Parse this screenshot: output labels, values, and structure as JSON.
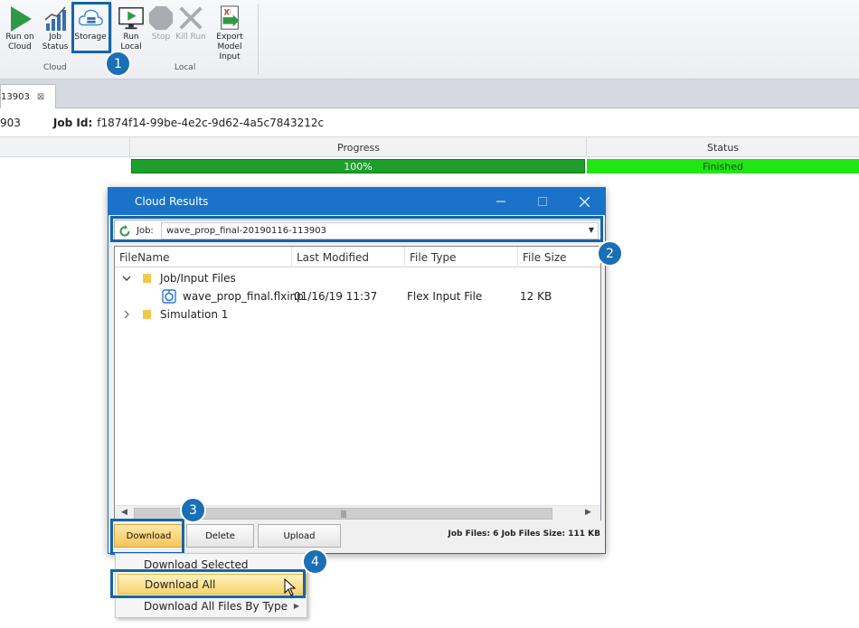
{
  "ribbon": {
    "buttons": [
      {
        "label_1": "Run on",
        "label_2": "Cloud",
        "icon": "play-icon",
        "color": "#2e9a47"
      },
      {
        "label_1": "Job",
        "label_2": "Status",
        "icon": "bar-chart-icon"
      },
      {
        "label_1": "Storage",
        "label_2": "",
        "icon": "cloud-storage-icon"
      },
      {
        "label_1": "Run",
        "label_2": "Local",
        "icon": "monitor-play-icon"
      },
      {
        "label_1": "Stop",
        "label_2": "",
        "icon": "stop-octagon-icon",
        "disabled": true
      },
      {
        "label_1": "Kill Run",
        "label_2": "",
        "icon": "x-icon",
        "disabled": true
      },
      {
        "label_1": "Export Model",
        "label_2": "Input",
        "icon": "export-document-icon"
      }
    ],
    "groups": {
      "cloud": "Cloud",
      "local": "Local"
    }
  },
  "callouts": {
    "one": "1",
    "two": "2",
    "three": "3",
    "four": "4"
  },
  "tab": {
    "label": "13903",
    "close": "⊠"
  },
  "jobline": {
    "prefix": "903",
    "job_id_label": "Job Id:",
    "job_id_value": "f1874f14-99be-4e2c-9d62-4a5c7843212c"
  },
  "grid": {
    "headers": {
      "progress": "Progress",
      "status": "Status"
    },
    "row": {
      "progress_text": "100%",
      "progress_value": 100,
      "status_text": "Finished"
    },
    "colors": {
      "progress": "#1e9e2a",
      "status": "#22e515"
    }
  },
  "dialog": {
    "title": "Cloud Results",
    "job_label": "Job:",
    "job_value": "wave_prop_final-20190116-113903",
    "columns": {
      "filename": "FileName",
      "modified": "Last Modified",
      "type": "File Type",
      "size": "File Size"
    },
    "tree": [
      {
        "name": "Job/Input Files",
        "expanded": true,
        "folder": true
      },
      {
        "name": "wave_prop_final.flxinp",
        "modified": "01/16/19 11:37",
        "type": "Flex Input File",
        "size": "12 KB",
        "folder": false
      },
      {
        "name": "Simulation 1",
        "expanded": false,
        "folder": true
      }
    ],
    "buttons": {
      "download": "Download",
      "delete": "Delete",
      "upload": "Upload"
    },
    "footer": {
      "files_label": "Job Files:",
      "files_value": "6",
      "size_label": "Job Files Size:",
      "size_value": "111 KB"
    }
  },
  "menu": {
    "items": [
      {
        "label": "Download Selected"
      },
      {
        "label": "Download All"
      },
      {
        "label": "Download All Files By Type",
        "submenu": true
      }
    ]
  }
}
